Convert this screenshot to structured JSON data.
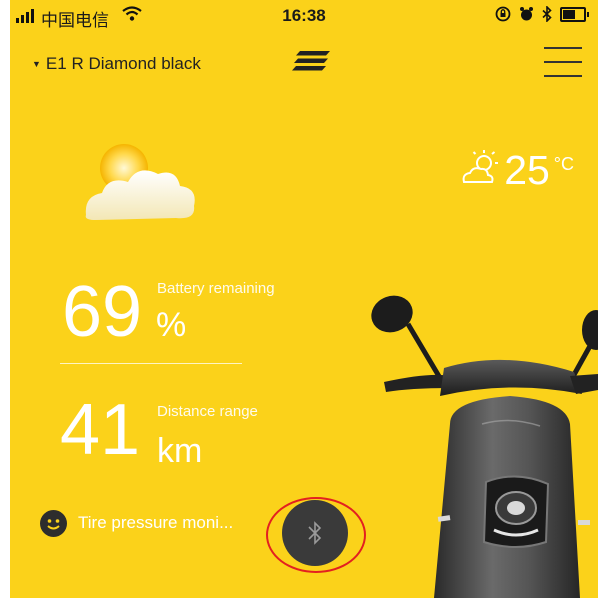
{
  "status_bar": {
    "carrier": "中国电信",
    "time": "16:38"
  },
  "header": {
    "vehicle_name": "E1 R Diamond black"
  },
  "weather": {
    "temperature": "25",
    "unit": "°C",
    "condition_icon": "partly-sunny-icon"
  },
  "battery": {
    "value": "69",
    "unit": "%",
    "label": "Battery remaining"
  },
  "range": {
    "value": "41",
    "unit": "km",
    "label": "Distance range"
  },
  "tire": {
    "label": "Tire pressure moni..."
  },
  "colors": {
    "background": "#fbd21a",
    "text": "#ffffff",
    "bluetooth_button": "#3a3a3a",
    "highlight_ring": "#e32020"
  }
}
